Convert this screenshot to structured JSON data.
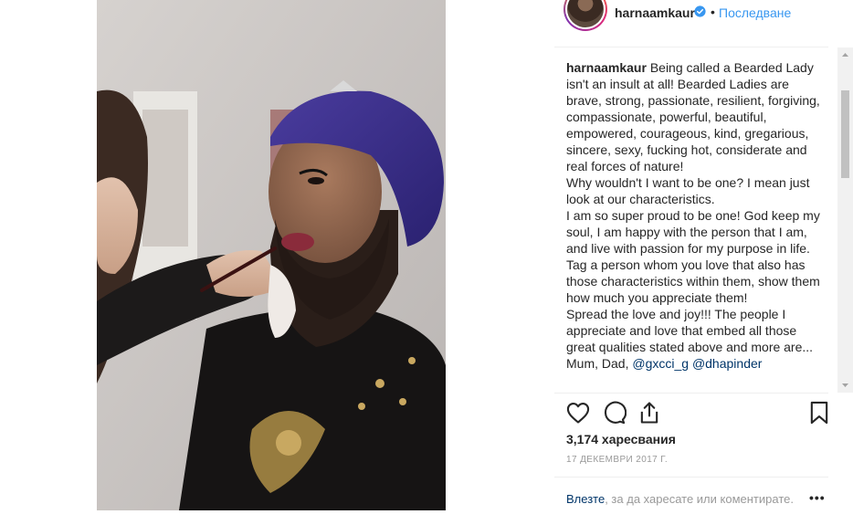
{
  "header": {
    "username": "harnaamkaur",
    "separator": "•",
    "follow_label": "Последване"
  },
  "caption": {
    "username": "harnaamkaur",
    "text": " Being called a Bearded Lady isn't an insult at all! Bearded Ladies are brave, strong, passionate, resilient, forgiving, compassionate, powerful, beautiful, empowered, courageous, kind, gregarious, sincere, sexy, fucking hot, considerate and real forces of nature!\nWhy wouldn't I want to be one? I mean just look at our characteristics.\nI am so super proud to be one! God keep my soul, I am happy with the person that I am, and live with passion for my purpose in life.\nTag a person whom you love that also has those characteristics within them, show them how much you appreciate them!\nSpread the love and joy!!! The people I appreciate and love that embed all those great qualities stated above and more are...\nMum, Dad, ",
    "mention_1": "@gxcci_g",
    "mention_2": "@dhapinder"
  },
  "actions": {
    "like_icon": "heart-icon",
    "comment_icon": "comment-icon",
    "share_icon": "share-icon",
    "save_icon": "bookmark-icon"
  },
  "likes_text": "3,174 харесвания",
  "date_text": "17 ДЕКЕМВРИ 2017 Г.",
  "footer": {
    "login_link": "Влезте",
    "login_rest": ", за да харесате или коментирате.",
    "more_label": "•••"
  },
  "colors": {
    "link": "#3897f0",
    "mention": "#003569",
    "text": "#262626",
    "muted": "#999999"
  }
}
